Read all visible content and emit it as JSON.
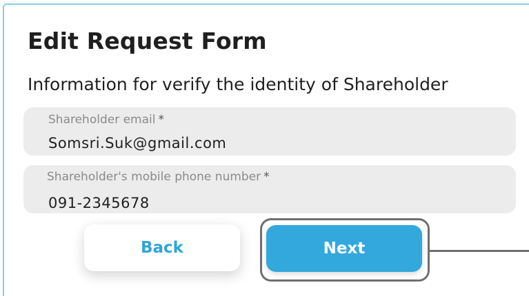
{
  "form": {
    "title": "Edit Request Form",
    "subtitle": "Information for verify the identity of Shareholder",
    "fields": [
      {
        "label": "Shareholder email",
        "required_mark": "*",
        "value": "Somsri.Suk@gmail.com"
      },
      {
        "label": "Shareholder's mobile phone number",
        "required_mark": "*",
        "value": "091-2345678"
      }
    ]
  },
  "buttons": {
    "back_label": "Back",
    "next_label": "Next"
  },
  "colors": {
    "accent": "#33a8dc",
    "card_border": "#86cfe0",
    "field_background": "#ececec",
    "highlight_outline": "#6e6e6e"
  }
}
